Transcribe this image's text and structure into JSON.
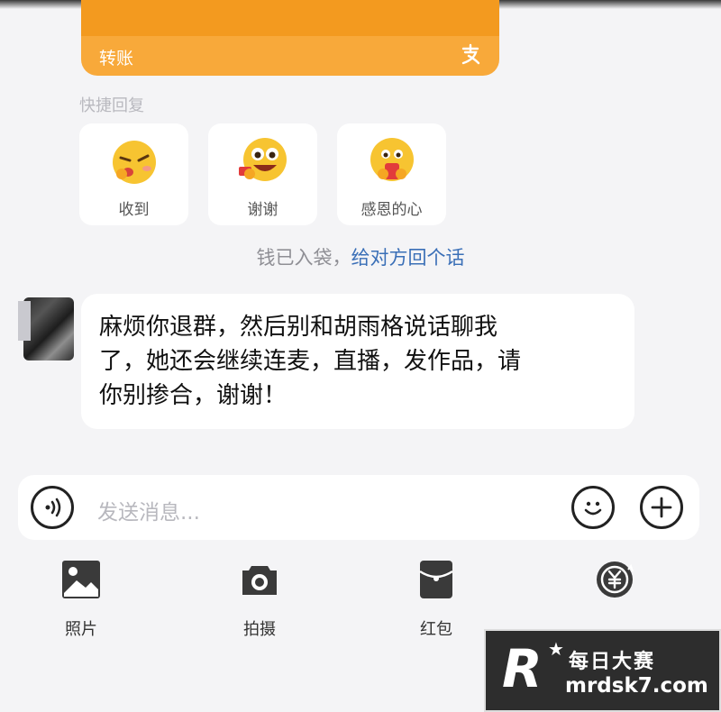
{
  "transfer": {
    "label": "转账",
    "icon": "alipay-icon",
    "color": "#f8a93a"
  },
  "quick_reply": {
    "title": "快捷回复",
    "items": [
      {
        "label": "收到",
        "icon": "wink-emoji-icon"
      },
      {
        "label": "谢谢",
        "icon": "grin-emoji-icon"
      },
      {
        "label": "感恩的心",
        "icon": "heart-emoji-icon"
      }
    ]
  },
  "notice": {
    "text": "钱已入袋，",
    "link": "给对方回个话"
  },
  "message": {
    "text": "麻烦你退群，然后别和胡雨格说话聊我\n了，她还会继续连麦，直播，发作品，请\n你别掺合，谢谢！"
  },
  "input": {
    "placeholder": "发送消息..."
  },
  "toolbar": [
    {
      "label": "照片",
      "icon": "photo-icon"
    },
    {
      "label": "拍摄",
      "icon": "camera-icon"
    },
    {
      "label": "红包",
      "icon": "red-packet-icon"
    },
    {
      "label": "",
      "icon": "yuan-transfer-icon"
    }
  ],
  "watermark": {
    "letter": "R",
    "name": "每日大赛",
    "url": "mrdsk7.com"
  }
}
